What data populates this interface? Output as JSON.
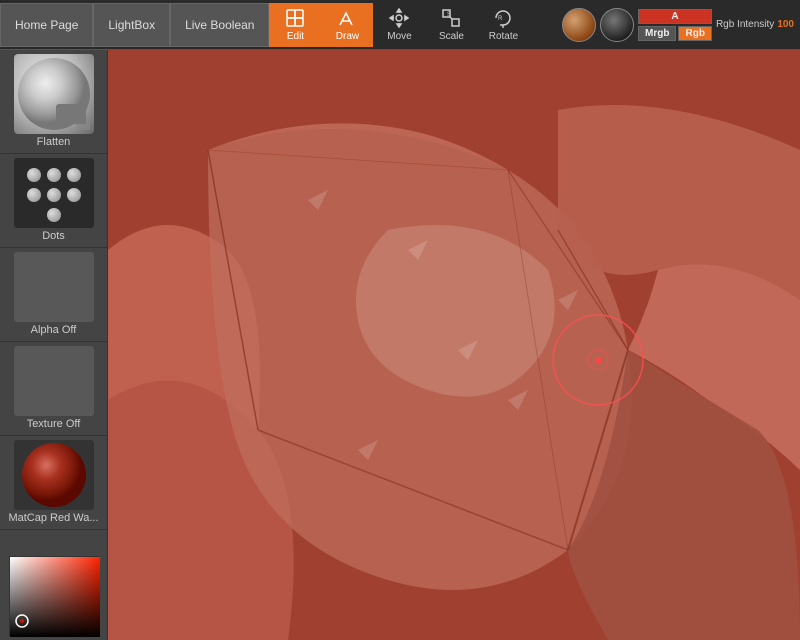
{
  "toolbar": {
    "home_label": "Home Page",
    "lightbox_label": "LightBox",
    "live_boolean_label": "Live Boolean",
    "edit_label": "Edit",
    "draw_label": "Draw",
    "move_label": "Move",
    "scale_label": "Scale",
    "rotate_label": "Rotate",
    "color_a_label": "A",
    "color_mrgb_label": "Mrgb",
    "color_rgb_label": "Rgb",
    "intensity_label": "Rgb Intensity",
    "intensity_value": "100"
  },
  "left_panel": {
    "flatten_label": "Flatten",
    "dots_label": "Dots",
    "alpha_label": "Alpha Off",
    "texture_label": "Texture Off",
    "matcap_label": "MatCap Red Wa..."
  }
}
